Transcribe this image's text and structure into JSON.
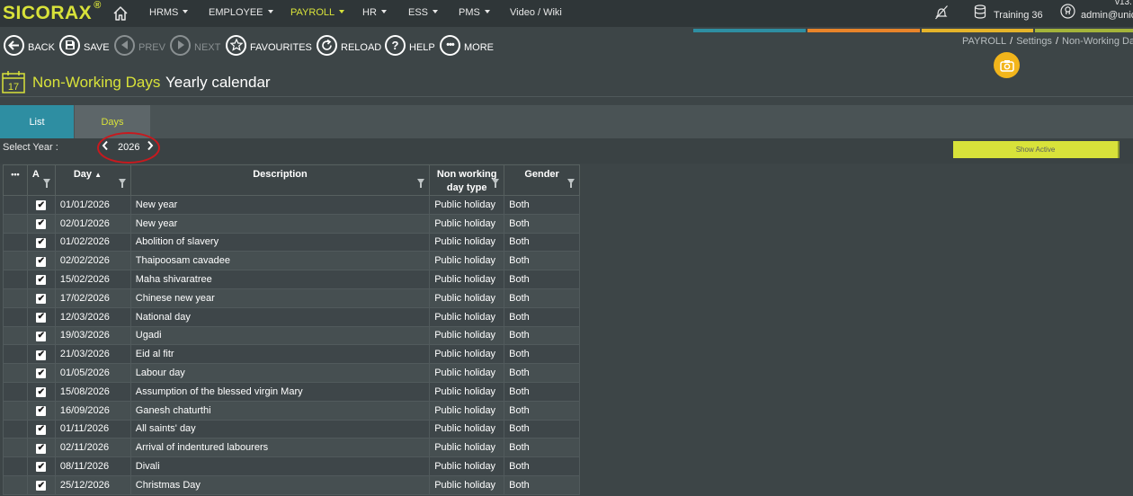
{
  "app": {
    "logo": "SICORAX",
    "reg": "®",
    "version": "v13."
  },
  "nav": {
    "items": [
      "HRMS",
      "EMPLOYEE",
      "PAYROLL",
      "HR",
      "ESS",
      "PMS",
      "Video / Wiki"
    ],
    "active": "PAYROLL"
  },
  "top_right": {
    "company": "Training 36",
    "user": "admin@unic"
  },
  "toolbar": {
    "back": "BACK",
    "save": "SAVE",
    "prev": "PREV",
    "next": "NEXT",
    "favourites": "FAVOURITES",
    "reload": "RELOAD",
    "help": "HELP",
    "more": "MORE"
  },
  "breadcrumb": {
    "b1": "PAYROLL",
    "b2": "Settings",
    "b3": "Non-Working Day"
  },
  "title": {
    "main": "Non-Working Days",
    "sub": "Yearly calendar",
    "icon_day": "17"
  },
  "tabs": {
    "list": "List",
    "days": "Days"
  },
  "year": {
    "label": "Select Year :",
    "value": "2026"
  },
  "show_active": "Show Active",
  "grid": {
    "headers": {
      "menu": "•••",
      "a": "A",
      "day": "Day",
      "desc": "Description",
      "type1": "Non working",
      "type2": "day type",
      "gender": "Gender"
    },
    "rows": [
      {
        "day": "01/01/2026",
        "desc": "New year",
        "type": "Public holiday",
        "gender": "Both"
      },
      {
        "day": "02/01/2026",
        "desc": "New year",
        "type": "Public holiday",
        "gender": "Both"
      },
      {
        "day": "01/02/2026",
        "desc": "Abolition of slavery",
        "type": "Public holiday",
        "gender": "Both"
      },
      {
        "day": "02/02/2026",
        "desc": "Thaipoosam cavadee",
        "type": "Public holiday",
        "gender": "Both"
      },
      {
        "day": "15/02/2026",
        "desc": "Maha shivaratree",
        "type": "Public holiday",
        "gender": "Both"
      },
      {
        "day": "17/02/2026",
        "desc": "Chinese new year",
        "type": "Public holiday",
        "gender": "Both"
      },
      {
        "day": "12/03/2026",
        "desc": "National day",
        "type": "Public holiday",
        "gender": "Both"
      },
      {
        "day": "19/03/2026",
        "desc": "Ugadi",
        "type": "Public holiday",
        "gender": "Both"
      },
      {
        "day": "21/03/2026",
        "desc": "Eid al fitr",
        "type": "Public holiday",
        "gender": "Both"
      },
      {
        "day": "01/05/2026",
        "desc": "Labour day",
        "type": "Public holiday",
        "gender": "Both"
      },
      {
        "day": "15/08/2026",
        "desc": "Assumption of the blessed virgin Mary",
        "type": "Public holiday",
        "gender": "Both"
      },
      {
        "day": "16/09/2026",
        "desc": "Ganesh chaturthi",
        "type": "Public holiday",
        "gender": "Both"
      },
      {
        "day": "01/11/2026",
        "desc": "All saints' day",
        "type": "Public holiday",
        "gender": "Both"
      },
      {
        "day": "02/11/2026",
        "desc": "Arrival of indentured labourers",
        "type": "Public holiday",
        "gender": "Both"
      },
      {
        "day": "08/11/2026",
        "desc": "Divali",
        "type": "Public holiday",
        "gender": "Both"
      },
      {
        "day": "25/12/2026",
        "desc": "Christmas Day",
        "type": "Public holiday",
        "gender": "Both"
      }
    ]
  },
  "colors": {
    "accent": "#d8e23a",
    "tab_active": "#2e8ea2",
    "camera": "#f2b51b",
    "bar1": "#2e8ea2",
    "bar2": "#e8842a",
    "bar3": "#e5b42a",
    "bar4": "#a4b43a"
  }
}
